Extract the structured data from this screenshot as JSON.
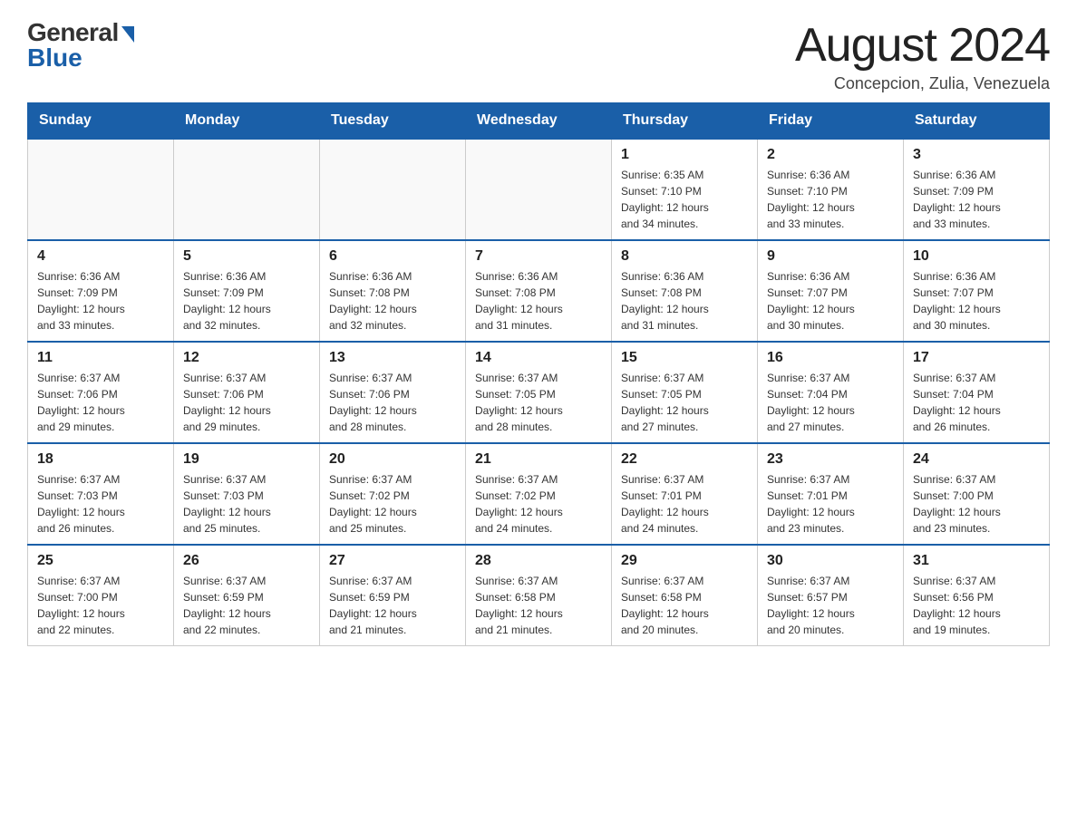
{
  "header": {
    "logo": {
      "general": "General",
      "blue": "Blue"
    },
    "title": "August 2024",
    "subtitle": "Concepcion, Zulia, Venezuela"
  },
  "weekdays": [
    "Sunday",
    "Monday",
    "Tuesday",
    "Wednesday",
    "Thursday",
    "Friday",
    "Saturday"
  ],
  "weeks": [
    {
      "days": [
        {
          "number": "",
          "info": ""
        },
        {
          "number": "",
          "info": ""
        },
        {
          "number": "",
          "info": ""
        },
        {
          "number": "",
          "info": ""
        },
        {
          "number": "1",
          "info": "Sunrise: 6:35 AM\nSunset: 7:10 PM\nDaylight: 12 hours\nand 34 minutes."
        },
        {
          "number": "2",
          "info": "Sunrise: 6:36 AM\nSunset: 7:10 PM\nDaylight: 12 hours\nand 33 minutes."
        },
        {
          "number": "3",
          "info": "Sunrise: 6:36 AM\nSunset: 7:09 PM\nDaylight: 12 hours\nand 33 minutes."
        }
      ]
    },
    {
      "days": [
        {
          "number": "4",
          "info": "Sunrise: 6:36 AM\nSunset: 7:09 PM\nDaylight: 12 hours\nand 33 minutes."
        },
        {
          "number": "5",
          "info": "Sunrise: 6:36 AM\nSunset: 7:09 PM\nDaylight: 12 hours\nand 32 minutes."
        },
        {
          "number": "6",
          "info": "Sunrise: 6:36 AM\nSunset: 7:08 PM\nDaylight: 12 hours\nand 32 minutes."
        },
        {
          "number": "7",
          "info": "Sunrise: 6:36 AM\nSunset: 7:08 PM\nDaylight: 12 hours\nand 31 minutes."
        },
        {
          "number": "8",
          "info": "Sunrise: 6:36 AM\nSunset: 7:08 PM\nDaylight: 12 hours\nand 31 minutes."
        },
        {
          "number": "9",
          "info": "Sunrise: 6:36 AM\nSunset: 7:07 PM\nDaylight: 12 hours\nand 30 minutes."
        },
        {
          "number": "10",
          "info": "Sunrise: 6:36 AM\nSunset: 7:07 PM\nDaylight: 12 hours\nand 30 minutes."
        }
      ]
    },
    {
      "days": [
        {
          "number": "11",
          "info": "Sunrise: 6:37 AM\nSunset: 7:06 PM\nDaylight: 12 hours\nand 29 minutes."
        },
        {
          "number": "12",
          "info": "Sunrise: 6:37 AM\nSunset: 7:06 PM\nDaylight: 12 hours\nand 29 minutes."
        },
        {
          "number": "13",
          "info": "Sunrise: 6:37 AM\nSunset: 7:06 PM\nDaylight: 12 hours\nand 28 minutes."
        },
        {
          "number": "14",
          "info": "Sunrise: 6:37 AM\nSunset: 7:05 PM\nDaylight: 12 hours\nand 28 minutes."
        },
        {
          "number": "15",
          "info": "Sunrise: 6:37 AM\nSunset: 7:05 PM\nDaylight: 12 hours\nand 27 minutes."
        },
        {
          "number": "16",
          "info": "Sunrise: 6:37 AM\nSunset: 7:04 PM\nDaylight: 12 hours\nand 27 minutes."
        },
        {
          "number": "17",
          "info": "Sunrise: 6:37 AM\nSunset: 7:04 PM\nDaylight: 12 hours\nand 26 minutes."
        }
      ]
    },
    {
      "days": [
        {
          "number": "18",
          "info": "Sunrise: 6:37 AM\nSunset: 7:03 PM\nDaylight: 12 hours\nand 26 minutes."
        },
        {
          "number": "19",
          "info": "Sunrise: 6:37 AM\nSunset: 7:03 PM\nDaylight: 12 hours\nand 25 minutes."
        },
        {
          "number": "20",
          "info": "Sunrise: 6:37 AM\nSunset: 7:02 PM\nDaylight: 12 hours\nand 25 minutes."
        },
        {
          "number": "21",
          "info": "Sunrise: 6:37 AM\nSunset: 7:02 PM\nDaylight: 12 hours\nand 24 minutes."
        },
        {
          "number": "22",
          "info": "Sunrise: 6:37 AM\nSunset: 7:01 PM\nDaylight: 12 hours\nand 24 minutes."
        },
        {
          "number": "23",
          "info": "Sunrise: 6:37 AM\nSunset: 7:01 PM\nDaylight: 12 hours\nand 23 minutes."
        },
        {
          "number": "24",
          "info": "Sunrise: 6:37 AM\nSunset: 7:00 PM\nDaylight: 12 hours\nand 23 minutes."
        }
      ]
    },
    {
      "days": [
        {
          "number": "25",
          "info": "Sunrise: 6:37 AM\nSunset: 7:00 PM\nDaylight: 12 hours\nand 22 minutes."
        },
        {
          "number": "26",
          "info": "Sunrise: 6:37 AM\nSunset: 6:59 PM\nDaylight: 12 hours\nand 22 minutes."
        },
        {
          "number": "27",
          "info": "Sunrise: 6:37 AM\nSunset: 6:59 PM\nDaylight: 12 hours\nand 21 minutes."
        },
        {
          "number": "28",
          "info": "Sunrise: 6:37 AM\nSunset: 6:58 PM\nDaylight: 12 hours\nand 21 minutes."
        },
        {
          "number": "29",
          "info": "Sunrise: 6:37 AM\nSunset: 6:58 PM\nDaylight: 12 hours\nand 20 minutes."
        },
        {
          "number": "30",
          "info": "Sunrise: 6:37 AM\nSunset: 6:57 PM\nDaylight: 12 hours\nand 20 minutes."
        },
        {
          "number": "31",
          "info": "Sunrise: 6:37 AM\nSunset: 6:56 PM\nDaylight: 12 hours\nand 19 minutes."
        }
      ]
    }
  ]
}
